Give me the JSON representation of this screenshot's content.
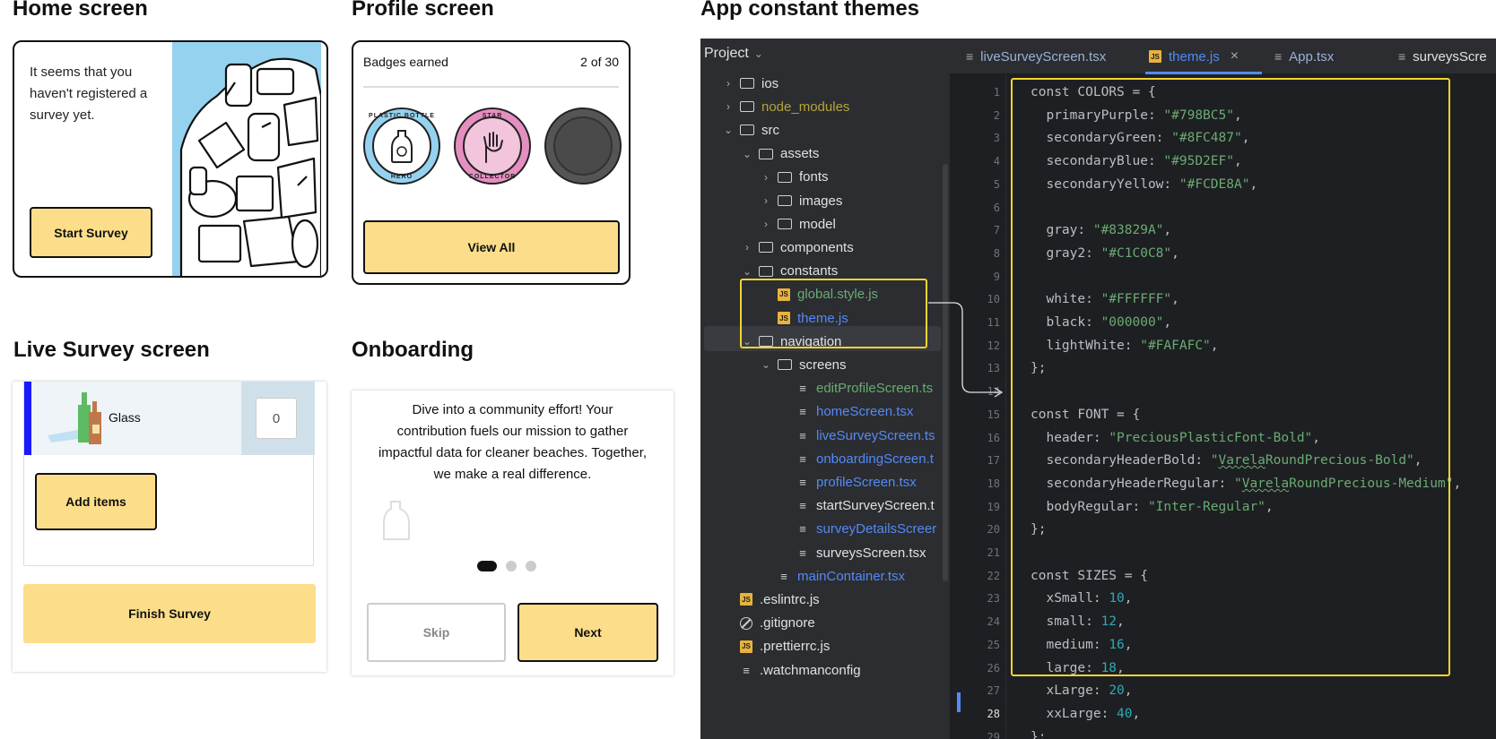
{
  "sections": {
    "home": "Home screen",
    "profile": "Profile screen",
    "themes": "App constant themes",
    "live": "Live Survey screen",
    "onboarding": "Onboarding"
  },
  "home": {
    "message": "It seems that you haven't registered a survey yet.",
    "start_button": "Start Survey"
  },
  "profile": {
    "badges_label": "Badges earned",
    "badges_count": "2 of 30",
    "badges": [
      {
        "top": "PLASTIC BOTTLE",
        "bottom": "HERO",
        "color": "#95d2ef"
      },
      {
        "top": "STAR",
        "bottom": "COLLECTOR",
        "color": "#e58fc1"
      },
      {
        "top": "",
        "bottom": "",
        "color": "#555555"
      }
    ],
    "view_all": "View All"
  },
  "live": {
    "item_label": "Glass",
    "item_count": "0",
    "add_items": "Add items",
    "finish": "Finish Survey"
  },
  "onboarding": {
    "text": "Dive into a community effort! Your contribution fuels our mission to gather impactful data for cleaner beaches. Together, we make a real difference.",
    "skip": "Skip",
    "next": "Next"
  },
  "ide": {
    "project_label": "Project",
    "tabs": [
      {
        "label": "liveSurveyScreen.tsx",
        "active": false,
        "icon": "file-icon"
      },
      {
        "label": "theme.js",
        "active": true,
        "icon": "js-icon"
      },
      {
        "label": "App.tsx",
        "active": false,
        "icon": "file-icon"
      },
      {
        "label": "surveysScre",
        "active": false,
        "icon": "file-icon"
      }
    ],
    "close_glyph": "×",
    "tree": [
      {
        "label": "ios",
        "indent": 0,
        "kind": "folder",
        "chev": "›",
        "color": "#dfe1e5"
      },
      {
        "label": "node_modules",
        "indent": 0,
        "kind": "folder",
        "chev": "›",
        "color": "#b5a33f"
      },
      {
        "label": "src",
        "indent": 0,
        "kind": "folder",
        "chev": "⌄",
        "color": "#dfe1e5"
      },
      {
        "label": "assets",
        "indent": 1,
        "kind": "folder",
        "chev": "⌄",
        "color": "#dfe1e5"
      },
      {
        "label": "fonts",
        "indent": 2,
        "kind": "folder",
        "chev": "›",
        "color": "#dfe1e5"
      },
      {
        "label": "images",
        "indent": 2,
        "kind": "folder",
        "chev": "›",
        "color": "#dfe1e5"
      },
      {
        "label": "model",
        "indent": 2,
        "kind": "folder",
        "chev": "›",
        "color": "#dfe1e5"
      },
      {
        "label": "components",
        "indent": 1,
        "kind": "folder",
        "chev": "›",
        "color": "#dfe1e5"
      },
      {
        "label": "constants",
        "indent": 1,
        "kind": "folder",
        "chev": "⌄",
        "color": "#dfe1e5"
      },
      {
        "label": "global.style.js",
        "indent": 2,
        "kind": "js",
        "chev": "",
        "color": "#6aab73"
      },
      {
        "label": "theme.js",
        "indent": 2,
        "kind": "js",
        "chev": "",
        "color": "#548af7"
      },
      {
        "label": "navigation",
        "indent": 1,
        "kind": "folder",
        "chev": "⌄",
        "color": "#dfe1e5"
      },
      {
        "label": "screens",
        "indent": 2,
        "kind": "folder",
        "chev": "⌄",
        "color": "#dfe1e5"
      },
      {
        "label": "editProfileScreen.ts",
        "indent": 3,
        "kind": "file",
        "chev": "",
        "color": "#6aab73"
      },
      {
        "label": "homeScreen.tsx",
        "indent": 3,
        "kind": "file",
        "chev": "",
        "color": "#548af7"
      },
      {
        "label": "liveSurveyScreen.ts",
        "indent": 3,
        "kind": "file",
        "chev": "",
        "color": "#548af7"
      },
      {
        "label": "onboardingScreen.t",
        "indent": 3,
        "kind": "file",
        "chev": "",
        "color": "#548af7"
      },
      {
        "label": "profileScreen.tsx",
        "indent": 3,
        "kind": "file",
        "chev": "",
        "color": "#548af7"
      },
      {
        "label": "startSurveyScreen.t",
        "indent": 3,
        "kind": "file",
        "chev": "",
        "color": "#dfe1e5"
      },
      {
        "label": "surveyDetailsScreer",
        "indent": 3,
        "kind": "file",
        "chev": "",
        "color": "#548af7"
      },
      {
        "label": "surveysScreen.tsx",
        "indent": 3,
        "kind": "file",
        "chev": "",
        "color": "#dfe1e5"
      },
      {
        "label": "mainContainer.tsx",
        "indent": 2,
        "kind": "file",
        "chev": "",
        "color": "#548af7"
      },
      {
        "label": ".eslintrc.js",
        "indent": 0,
        "kind": "js",
        "chev": "",
        "color": "#dfe1e5"
      },
      {
        "label": ".gitignore",
        "indent": 0,
        "kind": "ignore",
        "chev": "",
        "color": "#dfe1e5"
      },
      {
        "label": ".prettierrc.js",
        "indent": 0,
        "kind": "js",
        "chev": "",
        "color": "#dfe1e5"
      },
      {
        "label": ".watchmanconfig",
        "indent": 0,
        "kind": "file",
        "chev": "",
        "color": "#dfe1e5"
      }
    ],
    "code": [
      {
        "n": "1",
        "parts": [
          [
            "t",
            "const COLORS = {"
          ]
        ]
      },
      {
        "n": "2",
        "parts": [
          [
            "t",
            "  primaryPurple: "
          ],
          [
            "s",
            "\"#798BC5\""
          ],
          [
            "t",
            ","
          ]
        ]
      },
      {
        "n": "3",
        "parts": [
          [
            "t",
            "  secondaryGreen: "
          ],
          [
            "s",
            "\"#8FC487\""
          ],
          [
            "t",
            ","
          ]
        ]
      },
      {
        "n": "4",
        "parts": [
          [
            "t",
            "  secondaryBlue: "
          ],
          [
            "s",
            "\"#95D2EF\""
          ],
          [
            "t",
            ","
          ]
        ]
      },
      {
        "n": "5",
        "parts": [
          [
            "t",
            "  secondaryYellow: "
          ],
          [
            "s",
            "\"#FCDE8A\""
          ],
          [
            "t",
            ","
          ]
        ]
      },
      {
        "n": "6",
        "parts": []
      },
      {
        "n": "7",
        "parts": [
          [
            "t",
            "  gray: "
          ],
          [
            "s",
            "\"#83829A\""
          ],
          [
            "t",
            ","
          ]
        ]
      },
      {
        "n": "8",
        "parts": [
          [
            "t",
            "  gray2: "
          ],
          [
            "s",
            "\"#C1C0C8\""
          ],
          [
            "t",
            ","
          ]
        ]
      },
      {
        "n": "9",
        "parts": []
      },
      {
        "n": "10",
        "parts": [
          [
            "t",
            "  white: "
          ],
          [
            "s",
            "\"#FFFFFF\""
          ],
          [
            "t",
            ","
          ]
        ]
      },
      {
        "n": "11",
        "parts": [
          [
            "t",
            "  black: "
          ],
          [
            "s",
            "\"000000\""
          ],
          [
            "t",
            ","
          ]
        ]
      },
      {
        "n": "12",
        "parts": [
          [
            "t",
            "  lightWhite: "
          ],
          [
            "s",
            "\"#FAFAFC\""
          ],
          [
            "t",
            ","
          ]
        ]
      },
      {
        "n": "13",
        "parts": [
          [
            "t",
            "};"
          ]
        ]
      },
      {
        "n": "14",
        "parts": []
      },
      {
        "n": "15",
        "parts": [
          [
            "t",
            "const FONT = {"
          ]
        ]
      },
      {
        "n": "16",
        "parts": [
          [
            "t",
            "  header: "
          ],
          [
            "s",
            "\"PreciousPlasticFont-Bold\""
          ],
          [
            "t",
            ","
          ]
        ]
      },
      {
        "n": "17",
        "parts": [
          [
            "t",
            "  secondaryHeaderBold: "
          ],
          [
            "s",
            "\""
          ],
          [
            "sq",
            "Varela"
          ],
          [
            "s",
            "RoundPrecious-Bold\""
          ],
          [
            "t",
            ","
          ]
        ]
      },
      {
        "n": "18",
        "parts": [
          [
            "t",
            "  secondaryHeaderRegular: "
          ],
          [
            "s",
            "\""
          ],
          [
            "sq",
            "Varela"
          ],
          [
            "s",
            "RoundPrecious-Medium\""
          ],
          [
            "t",
            ","
          ]
        ]
      },
      {
        "n": "19",
        "parts": [
          [
            "t",
            "  bodyRegular: "
          ],
          [
            "s",
            "\"Inter-Regular\""
          ],
          [
            "t",
            ","
          ]
        ]
      },
      {
        "n": "20",
        "parts": [
          [
            "t",
            "};"
          ]
        ]
      },
      {
        "n": "21",
        "parts": []
      },
      {
        "n": "22",
        "parts": [
          [
            "t",
            "const SIZES = {"
          ]
        ]
      },
      {
        "n": "23",
        "parts": [
          [
            "t",
            "  xSmall: "
          ],
          [
            "n",
            "10"
          ],
          [
            "t",
            ","
          ]
        ]
      },
      {
        "n": "24",
        "parts": [
          [
            "t",
            "  small: "
          ],
          [
            "n",
            "12"
          ],
          [
            "t",
            ","
          ]
        ]
      },
      {
        "n": "25",
        "parts": [
          [
            "t",
            "  medium: "
          ],
          [
            "n",
            "16"
          ],
          [
            "t",
            ","
          ]
        ]
      },
      {
        "n": "26",
        "parts": [
          [
            "t",
            "  large: "
          ],
          [
            "n",
            "18"
          ],
          [
            "t",
            ","
          ]
        ]
      },
      {
        "n": "27",
        "parts": [
          [
            "t",
            "  xLarge: "
          ],
          [
            "n",
            "20"
          ],
          [
            "t",
            ","
          ]
        ]
      },
      {
        "n": "28",
        "parts": [
          [
            "t",
            "  xxLarge: "
          ],
          [
            "n",
            "40"
          ],
          [
            "t",
            ","
          ]
        ]
      },
      {
        "n": "29",
        "parts": [
          [
            "t",
            "};"
          ]
        ]
      }
    ],
    "colors": {
      "highlight": "#f0d531",
      "string": "#6aab73",
      "number": "#2aacb8"
    }
  }
}
